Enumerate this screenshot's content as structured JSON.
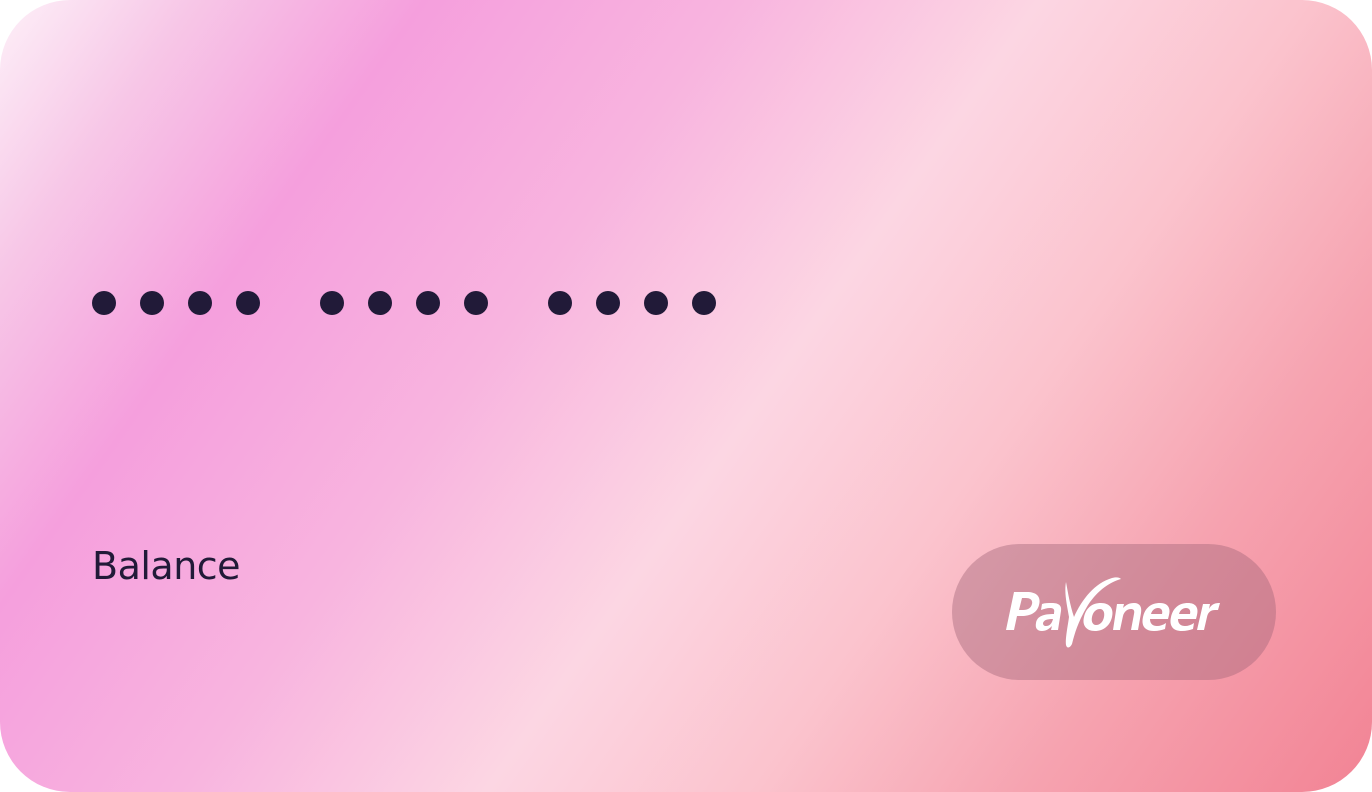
{
  "card": {
    "masked_number_groups": 3,
    "dots_per_group": 4,
    "balance_label": "Balance",
    "brand_name": "Payoneer",
    "brand_icon": "payoneer-logo-icon",
    "colors": {
      "dot": "#211a38",
      "text": "#211a38",
      "gradient_start": "#fdf0f8",
      "gradient_pink": "#f59fdd",
      "gradient_light": "#fcd6e3",
      "gradient_end": "#f28394",
      "badge": "rgba(160, 100, 120, 0.42)",
      "logo": "#ffffff"
    }
  }
}
